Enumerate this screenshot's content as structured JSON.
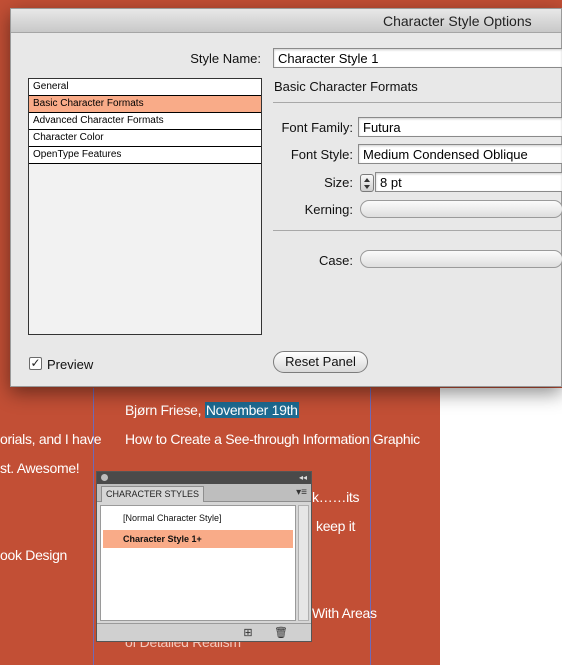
{
  "dialog": {
    "title": "Character Style Options",
    "style_name_label": "Style Name:",
    "style_name_value": "Character Style 1",
    "categories": [
      {
        "label": "General",
        "selected": false
      },
      {
        "label": "Basic Character Formats",
        "selected": true
      },
      {
        "label": "Advanced Character Formats",
        "selected": false
      },
      {
        "label": "Character Color",
        "selected": false
      },
      {
        "label": "OpenType Features",
        "selected": false
      }
    ],
    "section_title": "Basic Character Formats",
    "font_family_label": "Font Family:",
    "font_family_value": "Futura",
    "font_style_label": "Font Style:",
    "font_style_value": "Medium Condensed Oblique",
    "size_label": "Size:",
    "size_value": "8 pt",
    "kerning_label": "Kerning:",
    "kerning_value": "",
    "case_label": "Case:",
    "case_value": "",
    "preview_label": "Preview",
    "preview_checked": true,
    "checkmark": "✓",
    "reset_button_label": "Reset Panel"
  },
  "background": {
    "lines": [
      "Bjørn Friese, ",
      "November 19th",
      "How to Create a See-through Information Graphic",
      "orials, and I have",
      "st. Awesome!",
      "ook Design",
      "k……its",
      "keep it",
      "With Areas",
      "of Detailed Realism"
    ],
    "highlight_color": "#1d6b92",
    "page_color": "#c24f35"
  },
  "panel": {
    "tab_label": "CHARACTER STYLES",
    "collapse_glyph": "◂◂",
    "menu_glyph": "▾≡",
    "items": [
      {
        "label": "[Normal Character Style]",
        "selected": false
      },
      {
        "label": "Character Style 1+",
        "selected": true
      }
    ],
    "new_style_glyph": "⊞",
    "delete_glyph": "🗑"
  },
  "colors": {
    "selection": "#f9ab88",
    "dialog_bg": "#e8e8e8"
  }
}
